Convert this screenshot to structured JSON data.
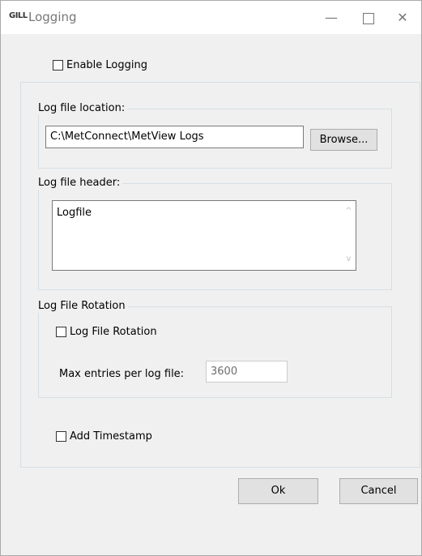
{
  "window": {
    "app_icon": "GILL",
    "title": "Logging",
    "minimize_glyph": "—",
    "close_glyph": "✕"
  },
  "enable_logging": {
    "label": "Enable Logging",
    "checked": false
  },
  "log_location": {
    "legend": "Log file location:",
    "path_value": "C:\\MetConnect\\MetView Logs",
    "browse_label": "Browse..."
  },
  "log_header": {
    "legend": "Log file header:",
    "value": "Logfile",
    "scroll_up": "^",
    "scroll_down": "v"
  },
  "rotation": {
    "legend": "Log File Rotation",
    "checkbox_label": "Log File Rotation",
    "checked": false,
    "max_entries_label": "Max entries per log file:",
    "max_entries_value": "3600"
  },
  "timestamp": {
    "label": "Add Timestamp",
    "checked": false
  },
  "buttons": {
    "ok": "Ok",
    "cancel": "Cancel"
  }
}
